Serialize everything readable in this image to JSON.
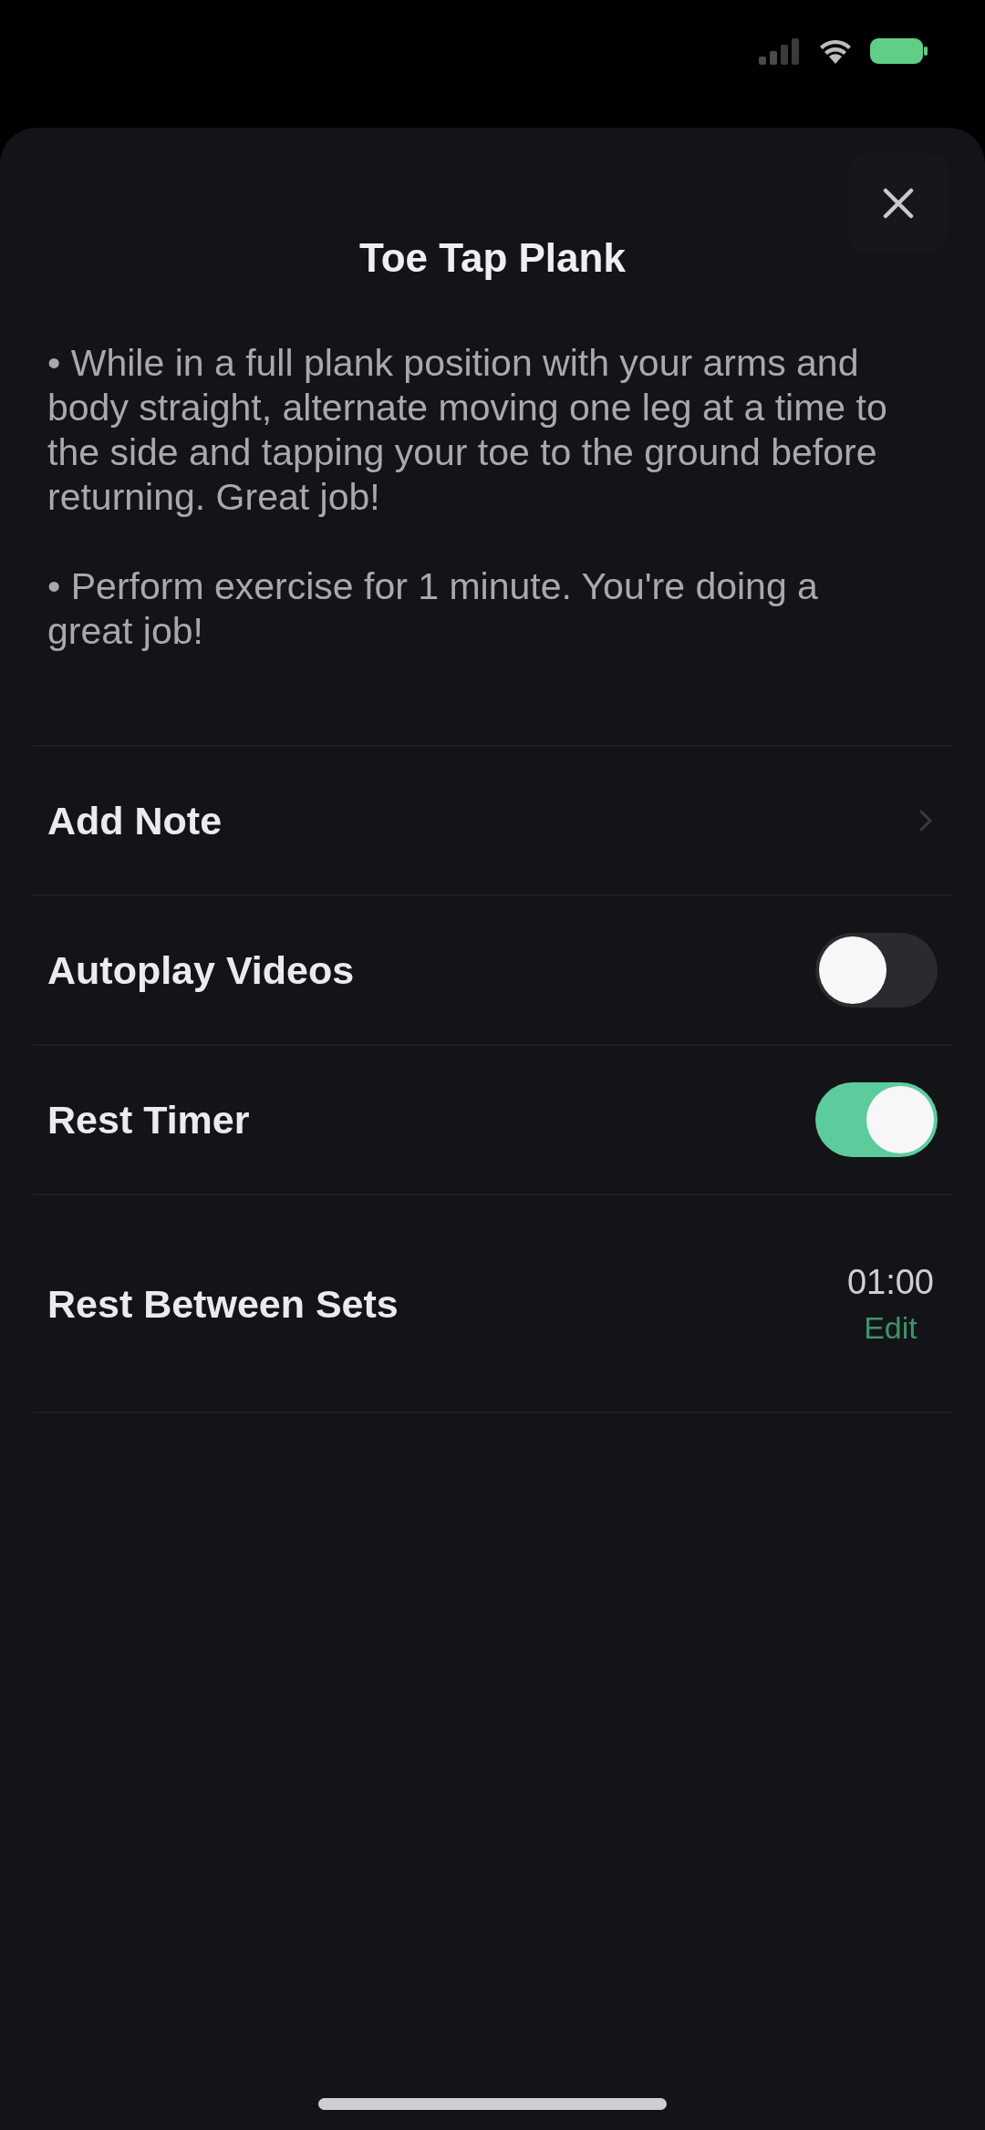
{
  "sheet": {
    "title": "Toe Tap Plank",
    "instructions": [
      "• While in a full plank position with your arms and body straight, alternate moving one leg at a time to the side and tapping your toe to the ground before returning. Great job!",
      "• Perform exercise for 1 minute. You're doing a great job!"
    ],
    "settings": [
      {
        "kind": "link",
        "label": "Add Note"
      },
      {
        "kind": "toggle",
        "label": "Autoplay Videos",
        "on": false
      },
      {
        "kind": "toggle",
        "label": "Rest Timer",
        "on": true
      },
      {
        "kind": "value",
        "label": "Rest Between Sets",
        "value": "01:00",
        "action": "Edit"
      }
    ]
  }
}
